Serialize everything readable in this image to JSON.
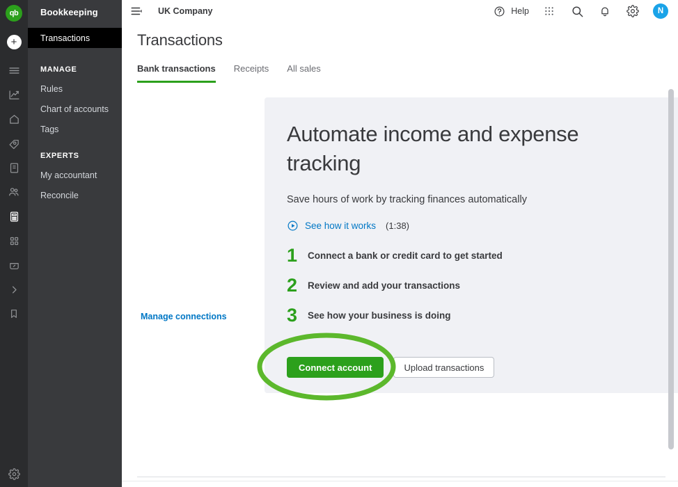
{
  "rail": {
    "logo_text": "qb",
    "logo_color": "#2CA01C",
    "add_label": "+",
    "icons": [
      {
        "name": "menu-icon"
      },
      {
        "name": "chart-line-icon"
      },
      {
        "name": "home-icon"
      },
      {
        "name": "sales-icon"
      },
      {
        "name": "invoice-icon"
      },
      {
        "name": "people-icon"
      },
      {
        "name": "calculator-icon"
      },
      {
        "name": "apps-grid-icon"
      },
      {
        "name": "banking-icon"
      },
      {
        "name": "chevron-right-icon"
      },
      {
        "name": "bookmark-icon"
      }
    ],
    "bottom_icon": "gear-icon"
  },
  "sidebar": {
    "title": "Bookkeeping",
    "active_item": "Transactions",
    "groups": [
      {
        "label": "MANAGE",
        "items": [
          "Rules",
          "Chart of accounts",
          "Tags"
        ]
      },
      {
        "label": "EXPERTS",
        "items": [
          "My accountant",
          "Reconcile"
        ]
      }
    ],
    "active_bg": "#000000",
    "panel_bg": "#393A3D"
  },
  "header": {
    "hamburger_icon": "collapse-menu-icon",
    "company": "UK Company",
    "help_label": "Help",
    "help_icon": "question-circle-icon",
    "apps_icon": "apps-grid-icon",
    "search_icon": "search-icon",
    "notifications_icon": "bell-icon",
    "settings_icon": "gear-icon",
    "avatar_initial": "N",
    "avatar_color": "#1AA3E8"
  },
  "page": {
    "title": "Transactions",
    "tabs": [
      {
        "label": "Bank transactions",
        "active": true
      },
      {
        "label": "Receipts",
        "active": false
      },
      {
        "label": "All sales",
        "active": false
      }
    ],
    "tab_accent": "#2CA01C"
  },
  "card": {
    "heading": "Automate income and expense tracking",
    "subheading": "Save hours of work by tracking finances automatically",
    "video_link": "See how it works",
    "video_duration": "(1:38)",
    "video_icon": "play-circle-icon",
    "steps": [
      {
        "number": "1",
        "text": "Connect a bank or credit card to get started"
      },
      {
        "number": "2",
        "text": "Review and add your transactions"
      },
      {
        "number": "3",
        "text": "See how your business is doing"
      }
    ],
    "primary_button": "Connect account",
    "secondary_button": "Upload transactions",
    "manage_link": "Manage connections",
    "background": "#F0F1F5",
    "link_color": "#0077C5",
    "accent_green": "#2CA01C"
  },
  "annotation": {
    "shape": "ellipse",
    "target": "Connect account",
    "color": "#5CB82C"
  }
}
